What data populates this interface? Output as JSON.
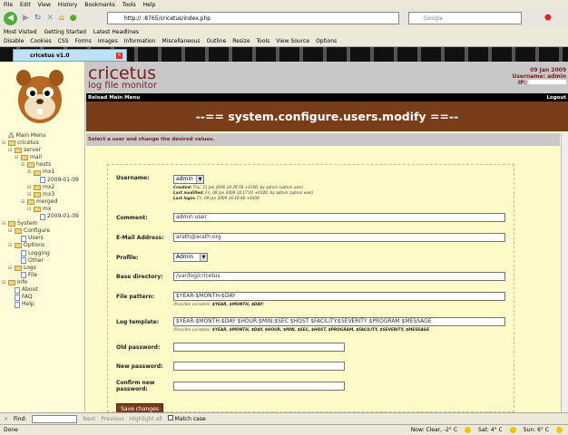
{
  "browser": {
    "menu": [
      "File",
      "Edit",
      "View",
      "History",
      "Bookmarks",
      "Tools",
      "Help"
    ],
    "url": "http://                  :8765/cricetus/index.php",
    "search_placeholder": "Google",
    "bookmarks": [
      "Most Visited",
      "Getting Started",
      "Latest Headlines"
    ],
    "devtools": [
      "Disable",
      "Cookies",
      "CSS",
      "Forms",
      "Images",
      "Information",
      "Miscellaneous",
      "Outline",
      "Resize",
      "Tools",
      "View Source",
      "Options"
    ],
    "tab_title": "cricetus v1.0"
  },
  "sidebar": {
    "tree": [
      {
        "label": "Main Menu",
        "depth": 0,
        "type": "root"
      },
      {
        "label": "cricetus",
        "depth": 0,
        "type": "folder"
      },
      {
        "label": "server",
        "depth": 1,
        "type": "folder"
      },
      {
        "label": "mail",
        "depth": 2,
        "type": "folder"
      },
      {
        "label": "hosts",
        "depth": 3,
        "type": "folder"
      },
      {
        "label": "mx1",
        "depth": 4,
        "type": "folder"
      },
      {
        "label": "2009-01-09",
        "depth": 5,
        "type": "file"
      },
      {
        "label": "mx2",
        "depth": 4,
        "type": "folder"
      },
      {
        "label": "mx3",
        "depth": 4,
        "type": "folder"
      },
      {
        "label": "merged",
        "depth": 3,
        "type": "folder"
      },
      {
        "label": "mx",
        "depth": 4,
        "type": "folder"
      },
      {
        "label": "2009-01-09",
        "depth": 5,
        "type": "file"
      },
      {
        "label": "System",
        "depth": 0,
        "type": "folder"
      },
      {
        "label": "Configure",
        "depth": 1,
        "type": "folder"
      },
      {
        "label": "Users",
        "depth": 2,
        "type": "file"
      },
      {
        "label": "Options",
        "depth": 1,
        "type": "folder"
      },
      {
        "label": "Logging",
        "depth": 2,
        "type": "file"
      },
      {
        "label": "Other",
        "depth": 2,
        "type": "file"
      },
      {
        "label": "Logs",
        "depth": 1,
        "type": "folder"
      },
      {
        "label": "File",
        "depth": 2,
        "type": "file"
      },
      {
        "label": "Info",
        "depth": 0,
        "type": "folder"
      },
      {
        "label": "About",
        "depth": 1,
        "type": "file"
      },
      {
        "label": "FAQ",
        "depth": 1,
        "type": "file"
      },
      {
        "label": "Help",
        "depth": 1,
        "type": "file"
      }
    ]
  },
  "header": {
    "title": "cricetus",
    "subtitle": "log file monitor",
    "date": "09 Jan 2009",
    "username": "Username: admin",
    "ip_label": "IP:"
  },
  "nav": {
    "reload": "Reload Main Menu",
    "logout": "Logout"
  },
  "banner": "--== system.configure.users.modify ==--",
  "instructions": "Select a user and change the desired values.",
  "form": {
    "username_label": "Username:",
    "username_value": "admin",
    "created": "Created:",
    "created_value": " Thu, 31 Jan 2006 10:26:58 +0100, by admin (admin user)",
    "modified": "Last modified:",
    "modified_value": " Fri, 09 Jan 2009 16:17:01 +0100, by admin (admin user)",
    "login": "Last login:",
    "login_value": " Fri, 09 Jan 2009 16:16:40 +0100",
    "comment_label": "Comment:",
    "comment_value": "admin user",
    "email_label": "E-Mail Address:",
    "email_value": "arath@arath.org",
    "profile_label": "Profile:",
    "profile_value": "Admin",
    "basedir_label": "Base directory:",
    "basedir_value": "/var/log/cricetus",
    "filepattern_label": "File pattern:",
    "filepattern_value": "$YEAR-$MONTH-$DAY",
    "filepattern_hint": "(Possible variables: ",
    "filepattern_vars": "$YEAR, $MONTH, $DAY",
    "logtemplate_label": "Log template:",
    "logtemplate_value": "$YEAR-$MONTH-$DAY $HOUR:$MIN:$SEC $HOST $FACILITY.$SEVERITY $PROGRAM $MESSAGE",
    "logtemplate_hint": "(Possible variables: ",
    "logtemplate_vars": "$YEAR, $MONTH, $DAY, $HOUR, $MIN, $SEC, $HOST, $PROGRAM, $FACILITY, $SEVERITY, $MESSAGE",
    "oldpw_label": "Old password:",
    "newpw_label": "New password:",
    "confirmpw_label": "Confirm new password:",
    "save": "Save changes"
  },
  "findbar": {
    "label": "Find:",
    "next": "Next",
    "previous": "Previous",
    "highlight": "Highlight all",
    "match_case": "Match case"
  },
  "status": {
    "text": "Done",
    "weather_now": "Now: Clear, -2° C",
    "weather_sat": "Sat: 4° C",
    "weather_sun": "Sun: 6° C"
  }
}
